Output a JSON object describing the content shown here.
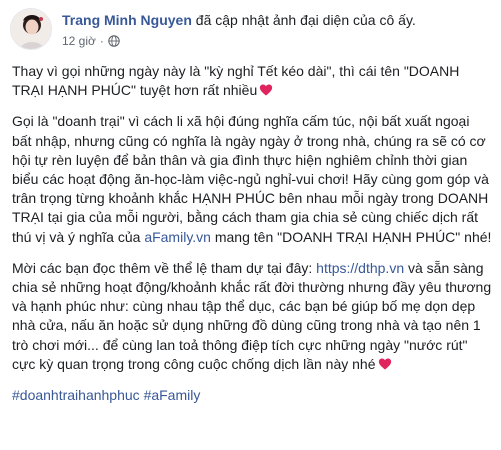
{
  "author": {
    "name": "Trang Minh Nguyen",
    "action": " đã cập nhật ảnh đại diện của cô ấy."
  },
  "meta": {
    "time": "12 giờ",
    "separator": "·",
    "privacy_icon": "globe-icon"
  },
  "paragraphs": {
    "p1_text": "Thay vì gọi những ngày này là \"kỳ nghỉ Tết kéo dài\", thì cái tên \"DOANH TRẠI HẠNH PHÚC\" tuyệt hơn rất nhiều",
    "p1_icon": "heart-icon",
    "p2_before_link": "Gọi là \"doanh trại\" vì cách li xã hội đúng nghĩa cấm túc, nội bất xuất ngoại bất nhập, nhưng cũng có nghĩa là ngày ngày ở trong nhà, chúng ra sẽ có cơ hội tự rèn luyện để bản thân và gia đình thực hiện nghiêm chỉnh thời gian biểu các hoạt động ăn-học-làm việc-ngủ nghỉ-vui chơi! Hãy cùng gom góp và trân trọng từng khoảnh khắc HẠNH PHÚC bên nhau mỗi ngày trong DOANH TRẠI tại gia của mỗi người, bằng cách tham gia chia sẻ cùng chiếc dịch rất thú vị và ý nghĩa của ",
    "p2_link": "aFamily.vn",
    "p2_after_link": " mang tên \"DOANH TRẠI HẠNH PHÚC\" nhé!",
    "p3_before_link": "Mời các bạn đọc thêm về thể lệ tham dự tại đây: ",
    "p3_link": "https://dthp.vn",
    "p3_after_link": " và sẵn sàng chia sẻ những hoạt động/khoảnh khắc rất đời thường nhưng đầy yêu thương và hạnh phúc như: cùng nhau tập thể dục, các bạn bé giúp bố mẹ dọn dẹp nhà cửa, nấu ăn hoặc sử dụng những đồ dùng cũng trong nhà và tạo nên 1 trò chơi mới... để cùng lan toả thông điệp tích cực những ngày \"nước rút\" cực kỳ quan trọng trong công cuộc chống dịch lần này nhé",
    "p3_icon": "heart-icon"
  },
  "hashtags": [
    "#doanhtraihanhphuc",
    "#aFamily"
  ],
  "colors": {
    "link": "#385898",
    "text": "#1c1e21",
    "meta": "#606770",
    "heart": "#e0245e"
  }
}
